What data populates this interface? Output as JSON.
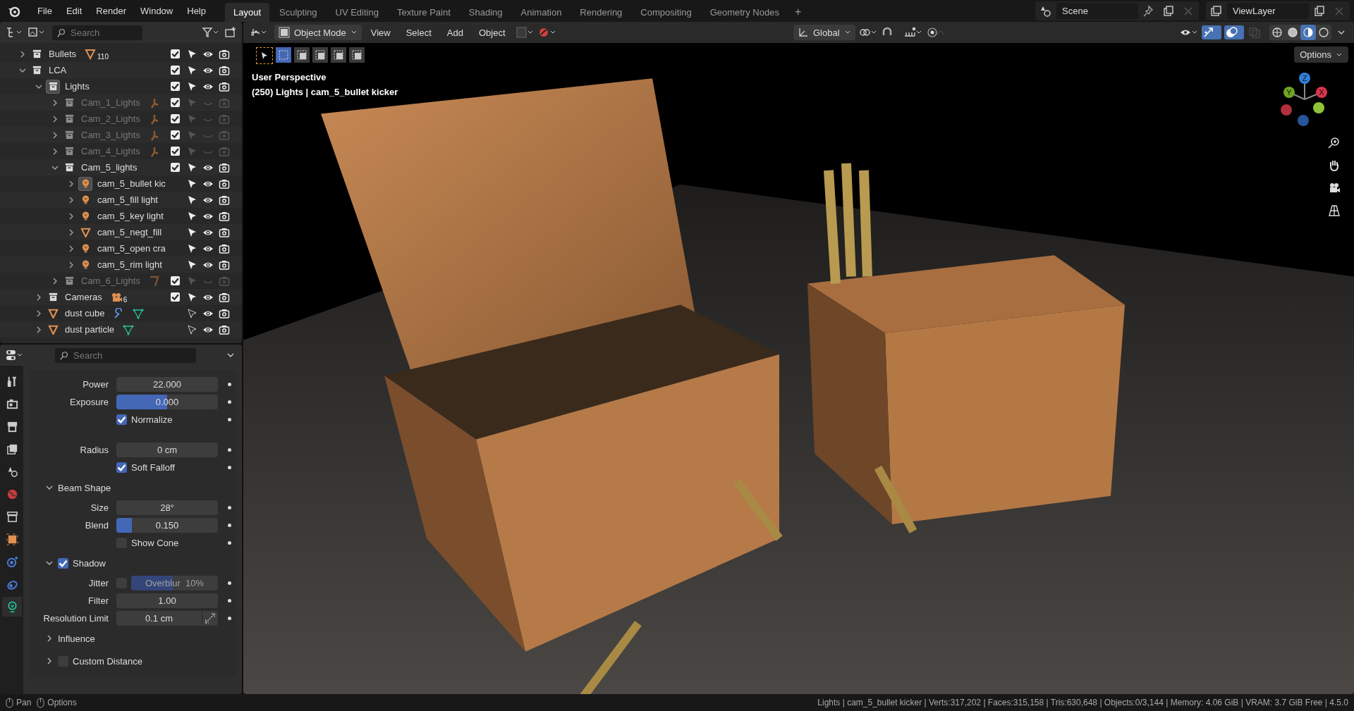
{
  "topbar": {
    "menus": [
      "File",
      "Edit",
      "Render",
      "Window",
      "Help"
    ],
    "workspaces": [
      {
        "label": "Layout",
        "selected": true
      },
      {
        "label": "Sculpting",
        "selected": false
      },
      {
        "label": "UV Editing",
        "selected": false
      },
      {
        "label": "Texture Paint",
        "selected": false
      },
      {
        "label": "Shading",
        "selected": false
      },
      {
        "label": "Animation",
        "selected": false
      },
      {
        "label": "Rendering",
        "selected": false
      },
      {
        "label": "Compositing",
        "selected": false
      },
      {
        "label": "Geometry Nodes",
        "selected": false
      }
    ],
    "add_tab": "+",
    "scene": "Scene",
    "view_layer": "ViewLayer"
  },
  "outliner": {
    "search": {
      "placeholder": "Search"
    },
    "items": [
      {
        "name": "Bullets",
        "kind": "collection",
        "expanded": false,
        "selected": false,
        "checked": true,
        "hidden": false,
        "selectable": true,
        "badges": [
          {
            "kind": "mesh",
            "count": "110"
          }
        ]
      },
      {
        "name": "LCA",
        "kind": "collection",
        "expanded": true,
        "selected": false,
        "checked": true,
        "hidden": false,
        "selectable": true,
        "children": [
          {
            "name": "Lights",
            "kind": "collection",
            "expanded": true,
            "selected": true,
            "checked": true,
            "hidden": false,
            "selectable": true,
            "children": [
              {
                "name": "Cam_1_Lights",
                "kind": "collection",
                "expanded": false,
                "selected": false,
                "checked": true,
                "hidden": true,
                "selectable": true,
                "badges": [
                  {
                    "kind": "light-data"
                  }
                ]
              },
              {
                "name": "Cam_2_Lights",
                "kind": "collection",
                "expanded": false,
                "selected": false,
                "checked": true,
                "hidden": true,
                "selectable": true,
                "badges": [
                  {
                    "kind": "light-data"
                  }
                ]
              },
              {
                "name": "Cam_3_Lights",
                "kind": "collection",
                "expanded": false,
                "selected": false,
                "checked": true,
                "hidden": true,
                "selectable": true,
                "badges": [
                  {
                    "kind": "light-data"
                  }
                ]
              },
              {
                "name": "Cam_4_Lights",
                "kind": "collection",
                "expanded": false,
                "selected": false,
                "checked": true,
                "hidden": true,
                "selectable": true,
                "badges": [
                  {
                    "kind": "light-data"
                  }
                ]
              },
              {
                "name": "Cam_5_lights",
                "kind": "collection",
                "expanded": true,
                "selected": false,
                "checked": true,
                "hidden": false,
                "selectable": true,
                "children": [
                  {
                    "name": "cam_5_bullet kic",
                    "kind": "light",
                    "expanded": false,
                    "selected": true,
                    "hidden": false,
                    "selectable": true
                  },
                  {
                    "name": "cam_5_fill light",
                    "kind": "light",
                    "expanded": false,
                    "selected": false,
                    "hidden": false,
                    "selectable": true
                  },
                  {
                    "name": "cam_5_key light",
                    "kind": "light",
                    "expanded": false,
                    "selected": false,
                    "hidden": false,
                    "selectable": true
                  },
                  {
                    "name": "cam_5_negt_fill",
                    "kind": "mesh",
                    "expanded": false,
                    "selected": false,
                    "hidden": false,
                    "selectable": true
                  },
                  {
                    "name": "cam_5_open cra",
                    "kind": "light",
                    "expanded": false,
                    "selected": false,
                    "hidden": false,
                    "selectable": true
                  },
                  {
                    "name": "cam_5_rim light",
                    "kind": "light",
                    "expanded": false,
                    "selected": false,
                    "hidden": false,
                    "selectable": true
                  }
                ]
              },
              {
                "name": "Cam_6_Lights",
                "kind": "collection",
                "expanded": false,
                "selected": false,
                "checked": true,
                "hidden": true,
                "selectable": true,
                "badges": [
                  {
                    "kind": "mesh-data"
                  }
                ]
              }
            ]
          },
          {
            "name": "Cameras",
            "kind": "collection",
            "expanded": false,
            "selected": false,
            "checked": true,
            "hidden": false,
            "selectable": true,
            "badges": [
              {
                "kind": "camera",
                "count": "6"
              }
            ]
          },
          {
            "name": "dust cube",
            "kind": "mesh",
            "expanded": false,
            "selected": false,
            "hidden": false,
            "selectable": false,
            "badges": [
              {
                "kind": "modifier"
              },
              {
                "kind": "vertices"
              }
            ]
          },
          {
            "name": "dust particle",
            "kind": "mesh",
            "expanded": false,
            "selected": false,
            "hidden": false,
            "selectable": false,
            "badges": [
              {
                "kind": "vertices"
              }
            ]
          }
        ]
      }
    ]
  },
  "properties": {
    "search": {
      "placeholder": "Search"
    },
    "tabs": [
      {
        "kind": "tool",
        "selected": false
      },
      {
        "kind": "render",
        "selected": false
      },
      {
        "kind": "output",
        "selected": false
      },
      {
        "kind": "view-layer",
        "selected": false
      },
      {
        "kind": "scene",
        "selected": false
      },
      {
        "kind": "world",
        "selected": false
      },
      {
        "kind": "collection",
        "selected": false
      },
      {
        "kind": "object",
        "selected": false
      },
      {
        "kind": "physics",
        "selected": false
      },
      {
        "kind": "constraints",
        "selected": false
      },
      {
        "kind": "light",
        "selected": true
      }
    ],
    "rows": [
      {
        "kind": "number",
        "label": "Power",
        "value": "22.000"
      },
      {
        "kind": "slider",
        "label": "Exposure",
        "value": "0.000",
        "level": 0.5
      },
      {
        "kind": "checkbox",
        "label": "Normalize",
        "checked": true
      },
      {
        "kind": "gap"
      },
      {
        "kind": "number",
        "label": "Radius",
        "value": "0 cm"
      },
      {
        "kind": "checkbox",
        "label": "Soft Falloff",
        "checked": true
      },
      {
        "kind": "panel",
        "label": "Beam Shape",
        "expanded": true
      },
      {
        "kind": "number",
        "label": "Size",
        "value": "28°"
      },
      {
        "kind": "slider",
        "label": "Blend",
        "value": "0.150",
        "level": 0.15
      },
      {
        "kind": "checkbox",
        "label": "Show Cone",
        "checked": false
      },
      {
        "kind": "panel",
        "label": "Shadow",
        "expanded": true,
        "checked": true
      },
      {
        "kind": "toggle-slider",
        "label": "Jitter",
        "checked": false,
        "value": "Overblur",
        "reading": "10%",
        "level": 0.48
      },
      {
        "kind": "number",
        "label": "Filter",
        "value": "1.00"
      },
      {
        "kind": "number-button",
        "label": "Resolution Limit",
        "value": "0.1 cm"
      },
      {
        "kind": "panel",
        "label": "Influence",
        "expanded": false
      },
      {
        "kind": "panel",
        "label": "Custom Distance",
        "expanded": false,
        "checked": false
      }
    ]
  },
  "viewport": {
    "mode": "Object Mode",
    "menus": [
      "View",
      "Select",
      "Add",
      "Object"
    ],
    "orientation": "Global",
    "options": "Options",
    "overlay_title": "User Perspective",
    "overlay_subtitle": "(250) Lights | cam_5_bullet kicker",
    "select_modes": [
      {
        "selected": true
      },
      {
        "selected": false
      },
      {
        "selected": false
      },
      {
        "selected": false
      },
      {
        "selected": false
      }
    ],
    "shading": [
      {
        "selected": false
      },
      {
        "selected": false
      },
      {
        "selected": true
      },
      {
        "selected": false
      }
    ],
    "gizmo": {
      "x": "X",
      "y": "Y",
      "z": "Z"
    }
  },
  "status_bar": {
    "hints": [
      "Pan",
      "Options"
    ],
    "stats": "Lights | cam_5_bullet kicker | Verts:317,202 | Faces:315,158 | Tris:630,648 | Objects:0/3,144 | Memory: 4.06 GiB | VRAM: 3.7 GiB Free | 4.5.0"
  }
}
